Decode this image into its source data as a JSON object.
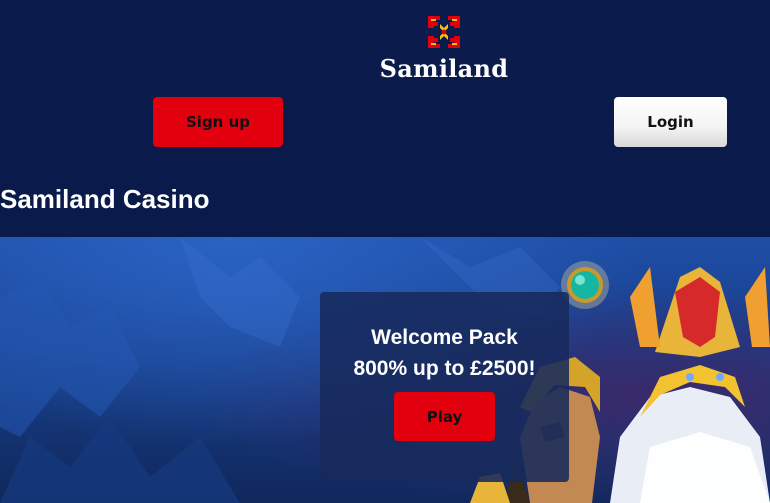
{
  "brand": {
    "name": "Samiland",
    "logo_colors": {
      "red": "#e2000f",
      "gold": "#f4c20d"
    }
  },
  "header": {
    "signup_label": "Sign up",
    "login_label": "Login"
  },
  "page_title": "Samiland Casino",
  "promo": {
    "line1": "Welcome Pack",
    "line2": "800% up to £2500!",
    "play_label": "Play"
  },
  "colors": {
    "header_bg": "#0a1a4a",
    "accent_red": "#e2000f",
    "hero_blue": "#1e4ea6"
  },
  "icons": [
    "samiland-logo-icon",
    "gem-icon"
  ]
}
